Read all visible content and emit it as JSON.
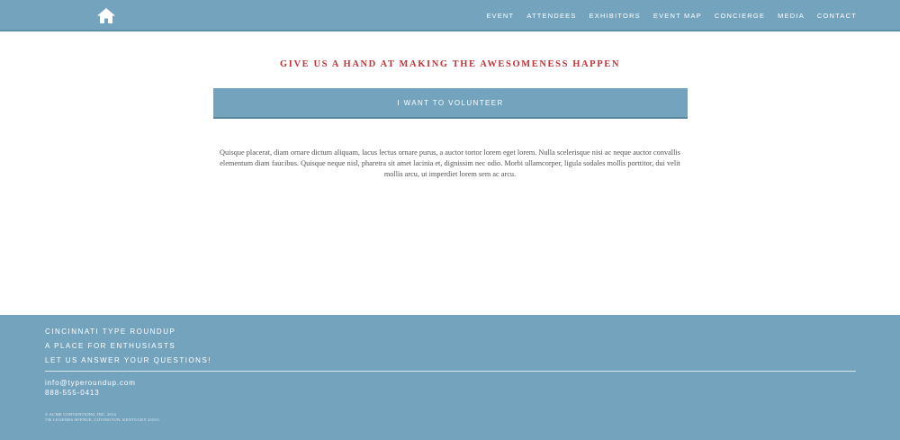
{
  "header": {
    "home_icon": "home-icon",
    "nav_items": [
      {
        "label": "EVENT"
      },
      {
        "label": "ATTENDEES"
      },
      {
        "label": "EXHIBITORS"
      },
      {
        "label": "EVENT MAP"
      },
      {
        "label": "CONCIERGE"
      },
      {
        "label": "MEDIA"
      },
      {
        "label": "CONTACT"
      }
    ]
  },
  "main": {
    "headline": "GIVE US A HAND AT MAKING THE AWESOMENESS HAPPEN",
    "volunteer_button": "I WANT TO VOLUNTEER",
    "body_text": "Quisque placerat, diam ornare dictum aliquam, lacus lectus ornare purus, a auctor tortor lorem eget lorem. Nulla scelerisque nisi ac neque auctor convallis elementum diam faucibus. Quisque neque nisl, pharetra sit amet lacinia et, dignissim nec odio. Morbi ullamcorper, ligula sodales mollis porttitor, dui velit mollis arcu, ut imperdiet lorem sem ac arcu."
  },
  "footer": {
    "line1": "CINCINNATI TYPE ROUNDUP",
    "line2": "A PLACE FOR ENTHUSIASTS",
    "line3": "LET US ANSWER YOUR QUESTIONS!",
    "email": "info@typeroundup.com",
    "phone": "888-555-0413",
    "copyright1": "© ACME CONVENTIONS, INC. 2014",
    "copyright2": "736 LEGENDS AVENUE, COVINGTON, KENTUCKY 41015"
  },
  "colors": {
    "brand_blue": "#74a3bd",
    "accent_red": "#c0343a"
  }
}
